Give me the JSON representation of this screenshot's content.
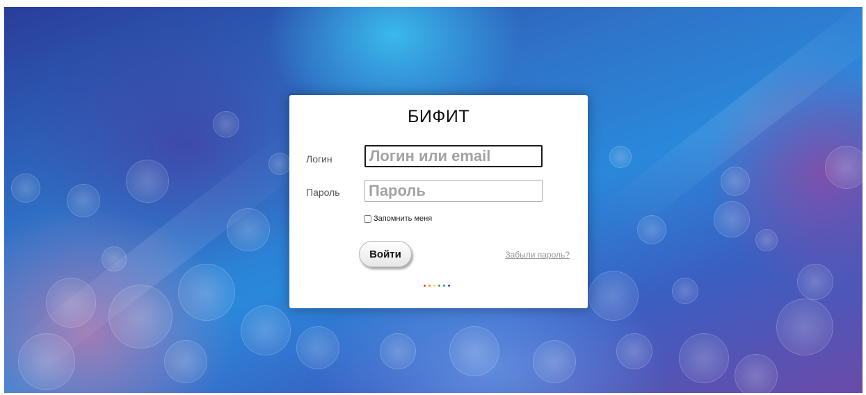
{
  "login_form": {
    "title": "БИФИТ",
    "login_label": "Логин",
    "login_placeholder": "Логин или email",
    "login_value": "",
    "password_label": "Пароль",
    "password_placeholder": "Пароль",
    "password_value": "",
    "remember_label": "Запомнить меня",
    "remember_checked": false,
    "submit_label": "Войти",
    "forgot_label": "Забыли пароль?"
  },
  "loader": {
    "dot_colors": [
      "#e53935",
      "#fb8c00",
      "#fdd835",
      "#43a047",
      "#1e88e5",
      "#8e24aa"
    ]
  }
}
